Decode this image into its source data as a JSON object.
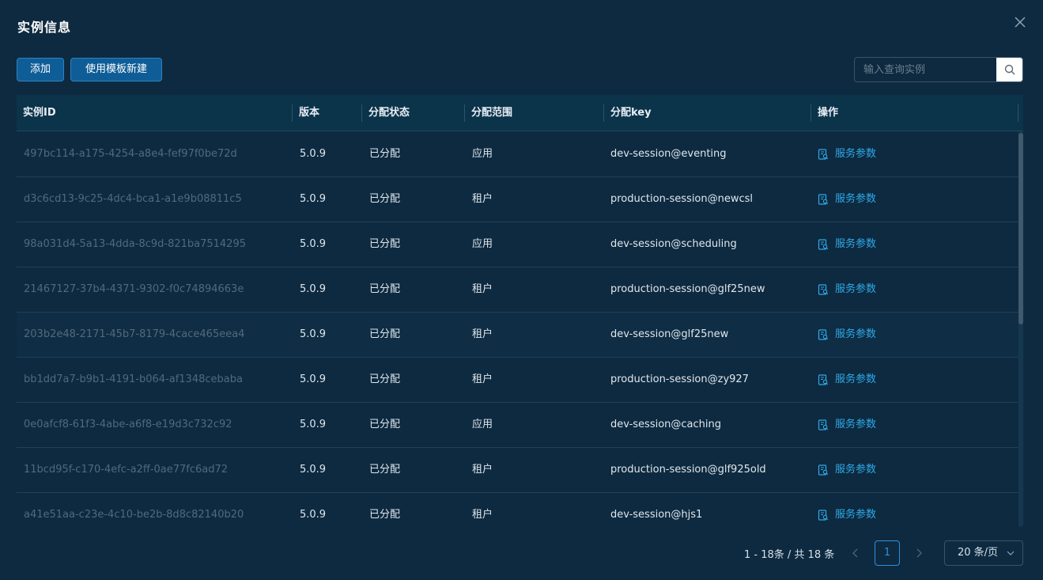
{
  "dialog": {
    "title": "实例信息",
    "add_label": "添加",
    "template_label": "使用模板新建",
    "search_placeholder": "输入查询实例"
  },
  "table": {
    "columns": [
      "实例ID",
      "版本",
      "分配状态",
      "分配范围",
      "分配key",
      "操作"
    ],
    "op_label": "服务参数",
    "rows": [
      {
        "id": "497bc114-a175-4254-a8e4-fef97f0be72d",
        "version": "5.0.9",
        "status": "已分配",
        "scope": "应用",
        "key": "dev-session@eventing"
      },
      {
        "id": "d3c6cd13-9c25-4dc4-bca1-a1e9b08811c5",
        "version": "5.0.9",
        "status": "已分配",
        "scope": "租户",
        "key": "production-session@newcsl"
      },
      {
        "id": "98a031d4-5a13-4dda-8c9d-821ba7514295",
        "version": "5.0.9",
        "status": "已分配",
        "scope": "应用",
        "key": "dev-session@scheduling"
      },
      {
        "id": "21467127-37b4-4371-9302-f0c74894663e",
        "version": "5.0.9",
        "status": "已分配",
        "scope": "租户",
        "key": "production-session@glf25new"
      },
      {
        "id": "203b2e48-2171-45b7-8179-4cace465eea4",
        "version": "5.0.9",
        "status": "已分配",
        "scope": "租户",
        "key": "dev-session@glf25new"
      },
      {
        "id": "bb1dd7a7-b9b1-4191-b064-af1348cebaba",
        "version": "5.0.9",
        "status": "已分配",
        "scope": "租户",
        "key": "production-session@zy927"
      },
      {
        "id": "0e0afcf8-61f3-4abe-a6f8-e19d3c732c92",
        "version": "5.0.9",
        "status": "已分配",
        "scope": "应用",
        "key": "dev-session@caching"
      },
      {
        "id": "11bcd95f-c170-4efc-a2ff-0ae77fc6ad72",
        "version": "5.0.9",
        "status": "已分配",
        "scope": "租户",
        "key": "production-session@glf925old"
      },
      {
        "id": "a41e51aa-c23e-4c10-be2b-8d8c82140b20",
        "version": "5.0.9",
        "status": "已分配",
        "scope": "租户",
        "key": "dev-session@hjs1"
      }
    ]
  },
  "pagination": {
    "total_text": "1 - 18条 / 共 18 条",
    "current_page": "1",
    "page_size": "20 条/页"
  },
  "colors": {
    "background": "#0e2a40",
    "primary_button": "#0f5d97",
    "link": "#2eaae8"
  }
}
